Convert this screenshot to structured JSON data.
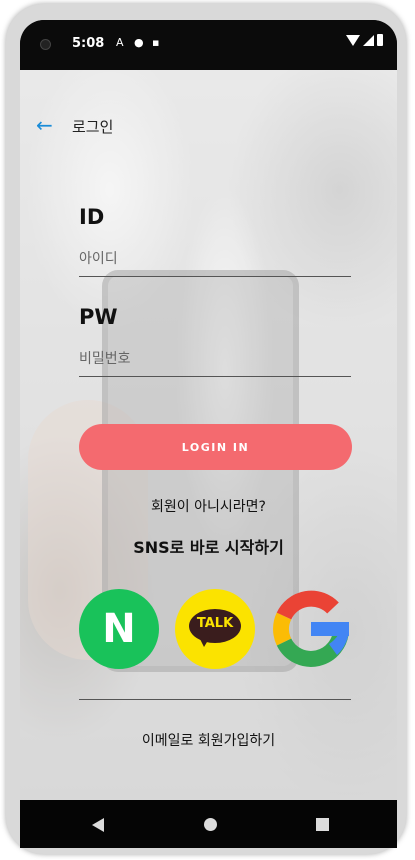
{
  "status_bar": {
    "time": "5:08",
    "notif_a": "A",
    "notif_b": "●",
    "notif_c": "▪"
  },
  "header": {
    "title": "로그인"
  },
  "form": {
    "id_label": "ID",
    "id_placeholder": "아이디",
    "pw_label": "PW",
    "pw_placeholder": "비밀번호",
    "login_label": "LOGIN IN"
  },
  "signup": {
    "question": "회원이 아니시라면?",
    "sns_title": "SNS로 바로 시작하기",
    "email_signup": "이메일로 회원가입하기"
  },
  "sns": {
    "naver_letter": "N",
    "kakao_text": "TALK"
  },
  "colors": {
    "accent": "#f46a6f",
    "naver": "#19c25a",
    "kakao": "#fbe300",
    "back_arrow": "#1a8cd8"
  }
}
